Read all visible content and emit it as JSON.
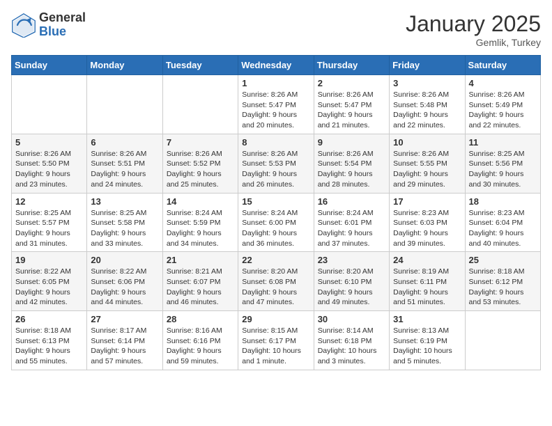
{
  "logo": {
    "general": "General",
    "blue": "Blue"
  },
  "title": "January 2025",
  "location": "Gemlik, Turkey",
  "days_of_week": [
    "Sunday",
    "Monday",
    "Tuesday",
    "Wednesday",
    "Thursday",
    "Friday",
    "Saturday"
  ],
  "weeks": [
    [
      {
        "num": "",
        "sunrise": "",
        "sunset": "",
        "daylight": ""
      },
      {
        "num": "",
        "sunrise": "",
        "sunset": "",
        "daylight": ""
      },
      {
        "num": "",
        "sunrise": "",
        "sunset": "",
        "daylight": ""
      },
      {
        "num": "1",
        "sunrise": "Sunrise: 8:26 AM",
        "sunset": "Sunset: 5:47 PM",
        "daylight": "Daylight: 9 hours and 20 minutes."
      },
      {
        "num": "2",
        "sunrise": "Sunrise: 8:26 AM",
        "sunset": "Sunset: 5:47 PM",
        "daylight": "Daylight: 9 hours and 21 minutes."
      },
      {
        "num": "3",
        "sunrise": "Sunrise: 8:26 AM",
        "sunset": "Sunset: 5:48 PM",
        "daylight": "Daylight: 9 hours and 22 minutes."
      },
      {
        "num": "4",
        "sunrise": "Sunrise: 8:26 AM",
        "sunset": "Sunset: 5:49 PM",
        "daylight": "Daylight: 9 hours and 22 minutes."
      }
    ],
    [
      {
        "num": "5",
        "sunrise": "Sunrise: 8:26 AM",
        "sunset": "Sunset: 5:50 PM",
        "daylight": "Daylight: 9 hours and 23 minutes."
      },
      {
        "num": "6",
        "sunrise": "Sunrise: 8:26 AM",
        "sunset": "Sunset: 5:51 PM",
        "daylight": "Daylight: 9 hours and 24 minutes."
      },
      {
        "num": "7",
        "sunrise": "Sunrise: 8:26 AM",
        "sunset": "Sunset: 5:52 PM",
        "daylight": "Daylight: 9 hours and 25 minutes."
      },
      {
        "num": "8",
        "sunrise": "Sunrise: 8:26 AM",
        "sunset": "Sunset: 5:53 PM",
        "daylight": "Daylight: 9 hours and 26 minutes."
      },
      {
        "num": "9",
        "sunrise": "Sunrise: 8:26 AM",
        "sunset": "Sunset: 5:54 PM",
        "daylight": "Daylight: 9 hours and 28 minutes."
      },
      {
        "num": "10",
        "sunrise": "Sunrise: 8:26 AM",
        "sunset": "Sunset: 5:55 PM",
        "daylight": "Daylight: 9 hours and 29 minutes."
      },
      {
        "num": "11",
        "sunrise": "Sunrise: 8:25 AM",
        "sunset": "Sunset: 5:56 PM",
        "daylight": "Daylight: 9 hours and 30 minutes."
      }
    ],
    [
      {
        "num": "12",
        "sunrise": "Sunrise: 8:25 AM",
        "sunset": "Sunset: 5:57 PM",
        "daylight": "Daylight: 9 hours and 31 minutes."
      },
      {
        "num": "13",
        "sunrise": "Sunrise: 8:25 AM",
        "sunset": "Sunset: 5:58 PM",
        "daylight": "Daylight: 9 hours and 33 minutes."
      },
      {
        "num": "14",
        "sunrise": "Sunrise: 8:24 AM",
        "sunset": "Sunset: 5:59 PM",
        "daylight": "Daylight: 9 hours and 34 minutes."
      },
      {
        "num": "15",
        "sunrise": "Sunrise: 8:24 AM",
        "sunset": "Sunset: 6:00 PM",
        "daylight": "Daylight: 9 hours and 36 minutes."
      },
      {
        "num": "16",
        "sunrise": "Sunrise: 8:24 AM",
        "sunset": "Sunset: 6:01 PM",
        "daylight": "Daylight: 9 hours and 37 minutes."
      },
      {
        "num": "17",
        "sunrise": "Sunrise: 8:23 AM",
        "sunset": "Sunset: 6:03 PM",
        "daylight": "Daylight: 9 hours and 39 minutes."
      },
      {
        "num": "18",
        "sunrise": "Sunrise: 8:23 AM",
        "sunset": "Sunset: 6:04 PM",
        "daylight": "Daylight: 9 hours and 40 minutes."
      }
    ],
    [
      {
        "num": "19",
        "sunrise": "Sunrise: 8:22 AM",
        "sunset": "Sunset: 6:05 PM",
        "daylight": "Daylight: 9 hours and 42 minutes."
      },
      {
        "num": "20",
        "sunrise": "Sunrise: 8:22 AM",
        "sunset": "Sunset: 6:06 PM",
        "daylight": "Daylight: 9 hours and 44 minutes."
      },
      {
        "num": "21",
        "sunrise": "Sunrise: 8:21 AM",
        "sunset": "Sunset: 6:07 PM",
        "daylight": "Daylight: 9 hours and 46 minutes."
      },
      {
        "num": "22",
        "sunrise": "Sunrise: 8:20 AM",
        "sunset": "Sunset: 6:08 PM",
        "daylight": "Daylight: 9 hours and 47 minutes."
      },
      {
        "num": "23",
        "sunrise": "Sunrise: 8:20 AM",
        "sunset": "Sunset: 6:10 PM",
        "daylight": "Daylight: 9 hours and 49 minutes."
      },
      {
        "num": "24",
        "sunrise": "Sunrise: 8:19 AM",
        "sunset": "Sunset: 6:11 PM",
        "daylight": "Daylight: 9 hours and 51 minutes."
      },
      {
        "num": "25",
        "sunrise": "Sunrise: 8:18 AM",
        "sunset": "Sunset: 6:12 PM",
        "daylight": "Daylight: 9 hours and 53 minutes."
      }
    ],
    [
      {
        "num": "26",
        "sunrise": "Sunrise: 8:18 AM",
        "sunset": "Sunset: 6:13 PM",
        "daylight": "Daylight: 9 hours and 55 minutes."
      },
      {
        "num": "27",
        "sunrise": "Sunrise: 8:17 AM",
        "sunset": "Sunset: 6:14 PM",
        "daylight": "Daylight: 9 hours and 57 minutes."
      },
      {
        "num": "28",
        "sunrise": "Sunrise: 8:16 AM",
        "sunset": "Sunset: 6:16 PM",
        "daylight": "Daylight: 9 hours and 59 minutes."
      },
      {
        "num": "29",
        "sunrise": "Sunrise: 8:15 AM",
        "sunset": "Sunset: 6:17 PM",
        "daylight": "Daylight: 10 hours and 1 minute."
      },
      {
        "num": "30",
        "sunrise": "Sunrise: 8:14 AM",
        "sunset": "Sunset: 6:18 PM",
        "daylight": "Daylight: 10 hours and 3 minutes."
      },
      {
        "num": "31",
        "sunrise": "Sunrise: 8:13 AM",
        "sunset": "Sunset: 6:19 PM",
        "daylight": "Daylight: 10 hours and 5 minutes."
      },
      {
        "num": "",
        "sunrise": "",
        "sunset": "",
        "daylight": ""
      }
    ]
  ]
}
